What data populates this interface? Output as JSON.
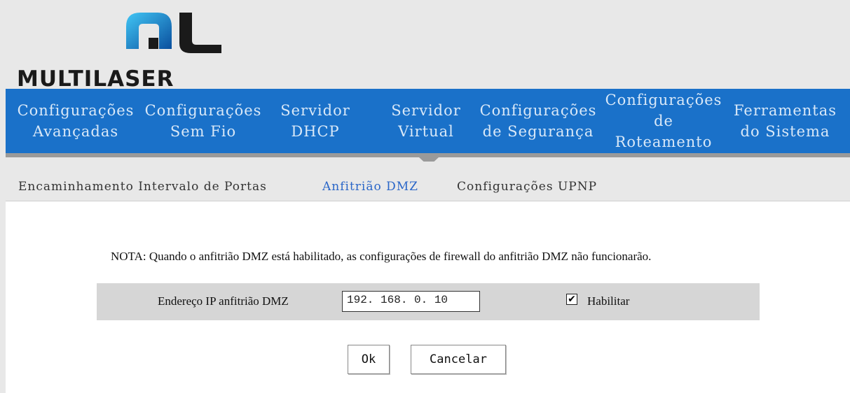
{
  "brand": {
    "name": "MULTILASER",
    "accent": "#1a71c9"
  },
  "nav": {
    "items": [
      {
        "label": "Configurações\nAvançadas"
      },
      {
        "label": "Configurações\nSem Fio"
      },
      {
        "label": "Servidor\nDHCP"
      },
      {
        "label": "Servidor\nVirtual"
      },
      {
        "label": "Configurações\nde Segurança"
      },
      {
        "label": "Configurações\nde\nRoteamento"
      },
      {
        "label": "Ferramentas\ndo Sistema"
      }
    ],
    "active_index": 5
  },
  "subnav": {
    "items": [
      {
        "label": "Encaminhamento Intervalo de Portas"
      },
      {
        "label": "Anfitrião DMZ"
      },
      {
        "label": "Configurações UPNP"
      }
    ],
    "active_index": 1
  },
  "dmz": {
    "note": "NOTA: Quando o anfitrião DMZ está habilitado, as configurações de firewall do anfitrião DMZ não funcionarão.",
    "ip_label": "Endereço IP anfitrião DMZ",
    "ip_value": "192. 168. 0. 10",
    "enable_checked": true,
    "enable_label": "Habilitar",
    "check_mark": "✔"
  },
  "buttons": {
    "ok": "Ok",
    "cancel": "Cancelar"
  }
}
